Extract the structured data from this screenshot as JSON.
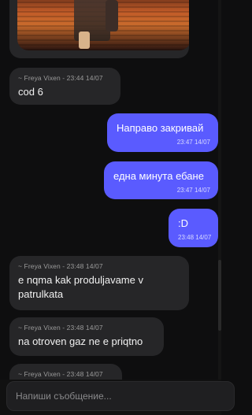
{
  "messages": [
    {
      "meta": "~ Freya Vixen - 23:44 14/07",
      "text": "cod 6"
    },
    {
      "text": "Направо закривай",
      "time": "23:47 14/07"
    },
    {
      "text": "една минута ебане",
      "time": "23:47 14/07"
    },
    {
      "text": ":D",
      "time": "23:48 14/07"
    },
    {
      "meta": "~ Freya Vixen - 23:48 14/07",
      "text": "e nqma kak produljavame v patrulkata"
    },
    {
      "meta": "~ Freya Vixen - 23:48 14/07",
      "text": "na otroven gaz ne e priqtno"
    },
    {
      "meta": "~ Freya Vixen - 23:48 14/07"
    }
  ],
  "composer": {
    "placeholder": "Напиши съобщение..."
  },
  "colors": {
    "outgoing": "#5a5bff",
    "incoming": "#262628",
    "background": "#0e0e0f"
  }
}
